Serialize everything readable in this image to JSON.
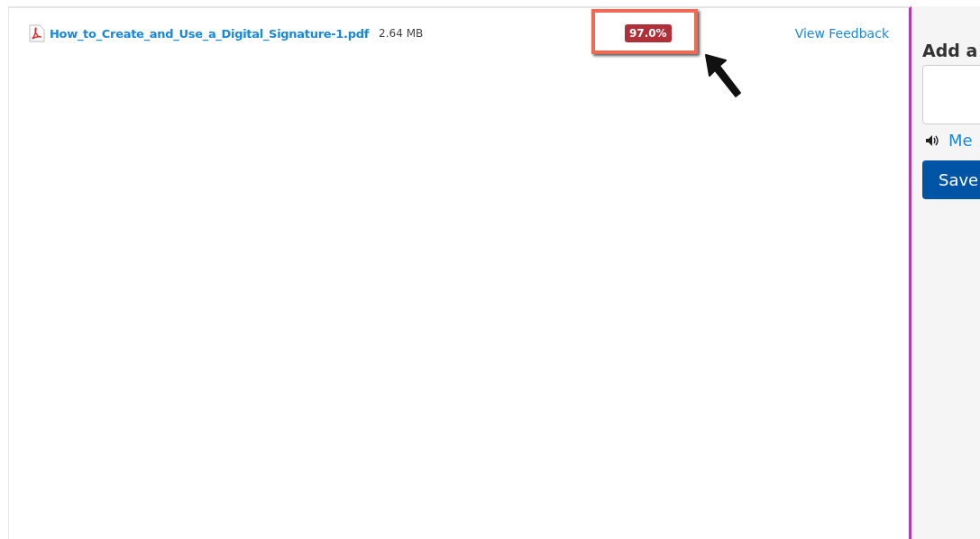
{
  "attachment": {
    "file_name": "How_to_Create_and_Use_a_Digital_Signature-1.pdf",
    "file_size": "2.64 MB"
  },
  "grade": {
    "score": "97.0%",
    "highlighted": true
  },
  "feedback_link": "View Feedback",
  "sidebar": {
    "comment_heading": "Add a",
    "media_link": "Me",
    "save_button": "Save"
  }
}
